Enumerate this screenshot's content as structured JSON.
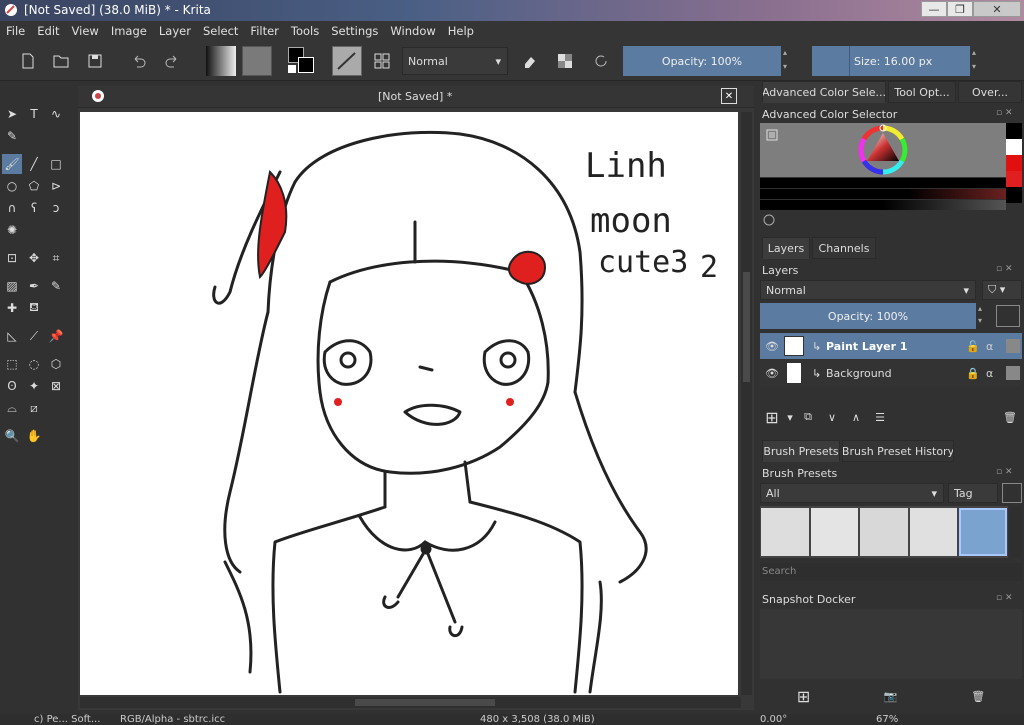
{
  "window": {
    "title": "[Not Saved]  (38.0 MiB)  * - Krita",
    "minimize": "—",
    "restore": "❐",
    "close": "✕"
  },
  "menu": [
    "File",
    "Edit",
    "View",
    "Image",
    "Layer",
    "Select",
    "Filter",
    "Tools",
    "Settings",
    "Window",
    "Help"
  ],
  "toolbar": {
    "blend_mode": "Normal",
    "opacity_label": "Opacity: 100%",
    "size_label": "Size: 16.00 px"
  },
  "canvas": {
    "tab_title": "[Not Saved]  *"
  },
  "drawing_text": {
    "line1": "Linh",
    "line2": "moon",
    "line3": "cute3",
    "line4": "2"
  },
  "dock": {
    "top_tabs": [
      "Advanced Color Sele...",
      "Tool Opt...",
      "Over..."
    ],
    "color_selector_title": "Advanced Color Selector",
    "layers_tabs": [
      "Layers",
      "Channels"
    ],
    "layers_title": "Layers",
    "layers_blend": "Normal",
    "layers_opacity": "Opacity:  100%",
    "layers": [
      {
        "name": "Paint Layer 1"
      },
      {
        "name": "Background"
      }
    ],
    "brush_tabs": [
      "Brush Presets",
      "Brush Preset History"
    ],
    "brush_title": "Brush Presets",
    "brush_filter": "All",
    "brush_tag": "Tag",
    "brush_search_placeholder": "Search",
    "snapshot_title": "Snapshot Docker"
  },
  "status": {
    "left": "c) Pe...  Soft...",
    "color_space": "RGB/Alpha - sbtrc.icc",
    "dims": "480 x 3,508 (38.0 MiB)",
    "rotation": "0.00°",
    "zoom": "67%"
  },
  "colors": {
    "accent": "#5b7ba0",
    "fg_color": "#000000",
    "bg_color": "#ffffff",
    "sketch_red": "#e0201e"
  }
}
